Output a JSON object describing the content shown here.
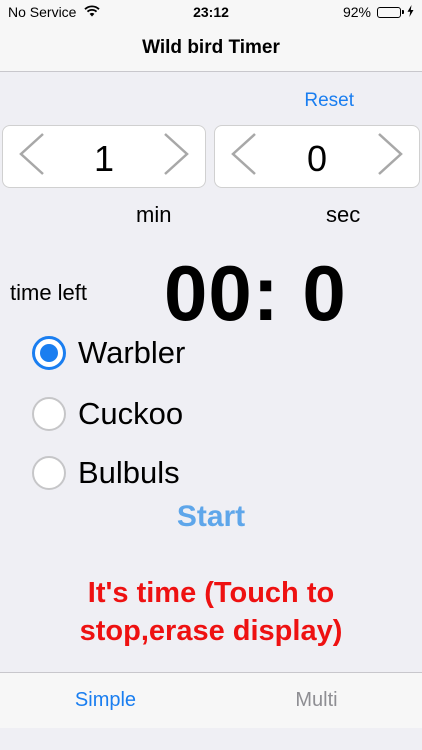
{
  "status_bar": {
    "carrier": "No Service",
    "time": "23:12",
    "battery_percent": "92%",
    "battery_level": 0.92
  },
  "nav": {
    "title": "Wild bird Timer"
  },
  "reset_label": "Reset",
  "minutes": {
    "value": "1",
    "unit": "min"
  },
  "seconds": {
    "value": "0",
    "unit": "sec"
  },
  "time_left": {
    "label": "time left",
    "display": "00: 0"
  },
  "birds": [
    {
      "label": "Warbler",
      "selected": true
    },
    {
      "label": "Cuckoo",
      "selected": false
    },
    {
      "label": "Bulbuls",
      "selected": false
    }
  ],
  "start_label": "Start",
  "alert": {
    "line1": "It's time (Touch to",
    "line2": "stop,erase display)"
  },
  "tabs": [
    {
      "label": "Simple",
      "active": true
    },
    {
      "label": "Multi",
      "active": false
    }
  ],
  "colors": {
    "accent": "#1a7ef0",
    "start": "#5ea6ea",
    "alert": "#ee1111",
    "inactive_tab": "#8e8e93"
  },
  "icons": {
    "wifi": "wifi-icon",
    "battery": "battery-icon",
    "charge": "charging-bolt-icon",
    "decrement": "chevron-left-icon",
    "increment": "chevron-right-icon"
  }
}
